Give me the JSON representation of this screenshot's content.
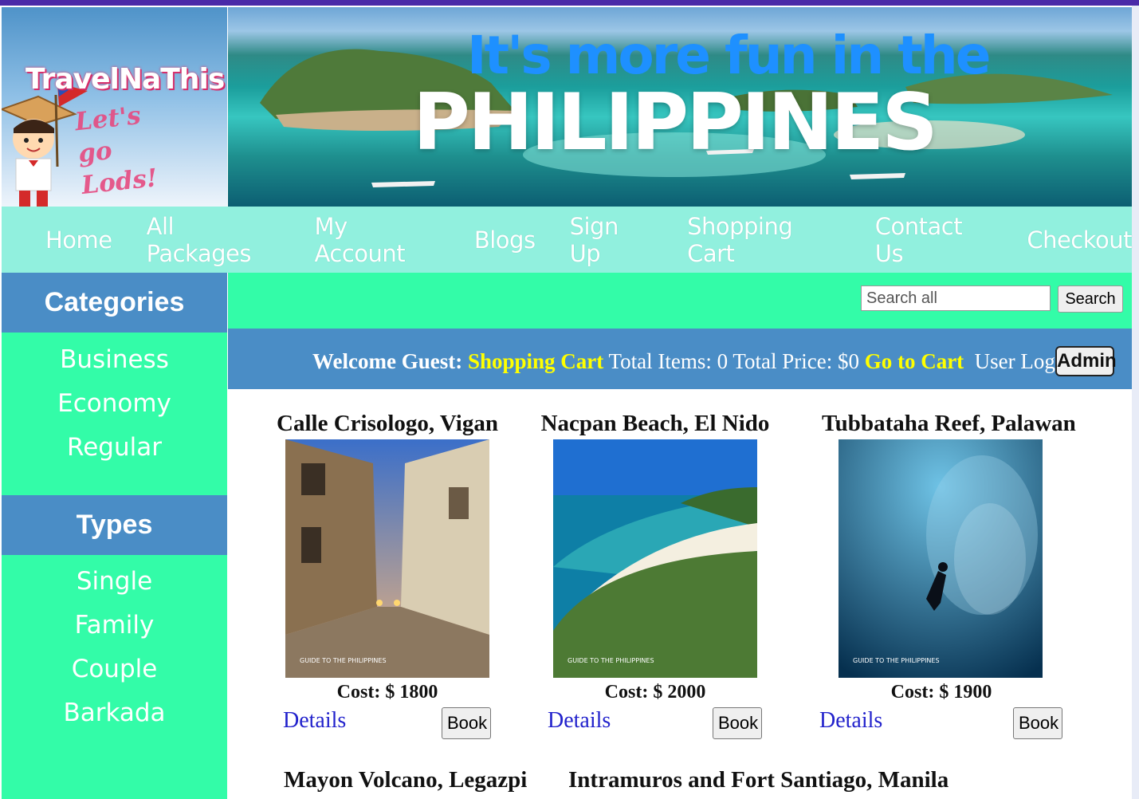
{
  "logo": {
    "title": "TravelNaThis",
    "tagline": "Let's go Lods!"
  },
  "banner": {
    "line1": "It's more fun in the",
    "line2": "PHILIPPINES"
  },
  "nav": [
    "Home",
    "All Packages",
    "My Account",
    "Blogs",
    "Sign Up",
    "Shopping Cart",
    "Contact Us",
    "Checkout"
  ],
  "sidebar": {
    "categories_title": "Categories",
    "categories": [
      "Business",
      "Economy",
      "Regular"
    ],
    "types_title": "Types",
    "types": [
      "Single",
      "Family",
      "Couple",
      "Barkada"
    ]
  },
  "search": {
    "placeholder": "Search all",
    "button": "Search"
  },
  "welcome": {
    "greeting": "Welcome Guest:",
    "cart_link": "Shopping Cart",
    "totals": "Total Items: 0 Total Price: $0",
    "go_to_cart": "Go to Cart",
    "login": "User Login",
    "admin": "Admin"
  },
  "products": [
    {
      "title": "Calle Crisologo, Vigan",
      "cost": "Cost: $ 1800",
      "details": "Details",
      "book": "Book"
    },
    {
      "title": "Nacpan Beach, El Nido",
      "cost": "Cost: $ 2000",
      "details": "Details",
      "book": "Book"
    },
    {
      "title": "Tubbataha Reef, Palawan",
      "cost": "Cost: $ 1900",
      "details": "Details",
      "book": "Book"
    }
  ],
  "products_row2": [
    {
      "title": "Mayon Volcano, Legazpi"
    },
    {
      "title": "Intramuros and Fort Santiago, Manila"
    }
  ],
  "image_watermark": "GUIDE TO THE PHILIPPINES",
  "colors": {
    "nav_bg": "#91f0de",
    "accent_green": "#33fca8",
    "panel_blue": "#4a8dc6",
    "highlight_yellow": "#ffff00",
    "link_blue": "#2222cc"
  }
}
